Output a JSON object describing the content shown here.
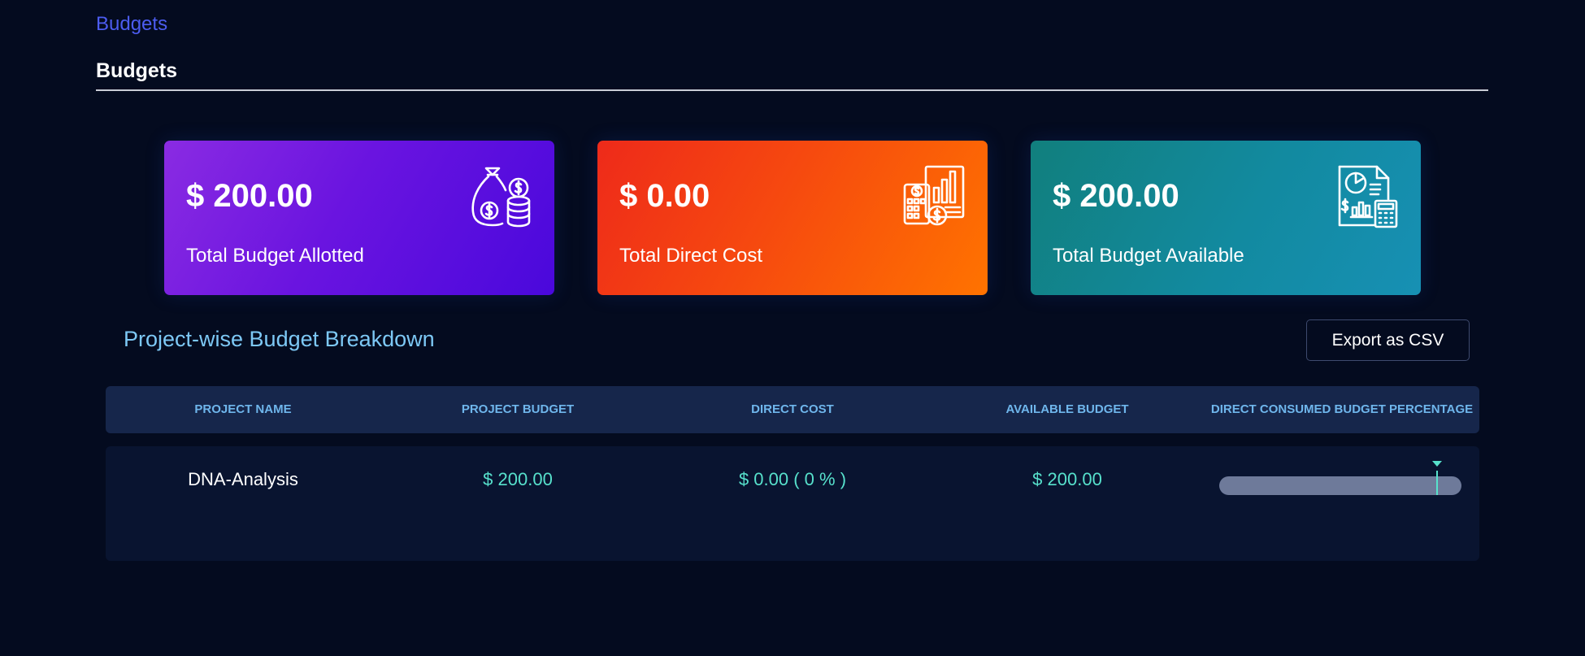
{
  "breadcrumb": {
    "link_label": "Budgets"
  },
  "page": {
    "title": "Budgets"
  },
  "summary_cards": [
    {
      "value": "$ 200.00",
      "label": "Total Budget Allotted",
      "icon": "money-bag-coins-icon"
    },
    {
      "value": "$ 0.00",
      "label": "Total Direct Cost",
      "icon": "calculator-chart-icon"
    },
    {
      "value": "$ 200.00",
      "label": "Total Budget Available",
      "icon": "report-calculator-icon"
    }
  ],
  "breakdown": {
    "title": "Project-wise Budget Breakdown",
    "export_label": "Export as CSV",
    "columns": [
      "PROJECT NAME",
      "PROJECT BUDGET",
      "DIRECT COST",
      "AVAILABLE BUDGET",
      "DIRECT CONSUMED BUDGET PERCENTAGE"
    ],
    "rows": [
      {
        "project_name": "DNA-Analysis",
        "project_budget": "$ 200.00",
        "direct_cost": "$ 0.00 ( 0 % )",
        "available_budget": "$ 200.00",
        "consumed_percent": 0
      }
    ]
  },
  "colors": {
    "background": "#040b1f",
    "breadcrumb_link": "#4c5cf0",
    "card_purple": "#6a14e0",
    "card_orange": "#f6490f",
    "card_teal": "#128aa0",
    "section_title": "#7dc8f5",
    "money_text": "#57e1cc",
    "progress_marker": "#57e1cc"
  }
}
